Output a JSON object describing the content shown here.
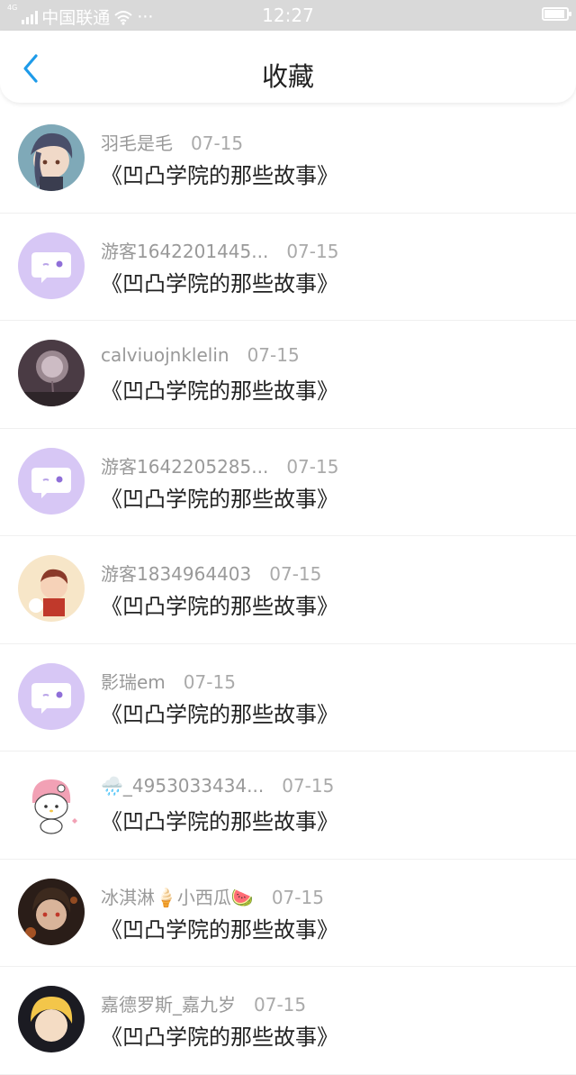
{
  "status_bar": {
    "signal_tag": "4G",
    "carrier": "中国联通",
    "more": "···",
    "time": "12:27"
  },
  "nav": {
    "title": "收藏"
  },
  "items": [
    {
      "username": "羽毛是毛",
      "date": "07-15",
      "title": "《凹凸学院的那些故事》"
    },
    {
      "username": "游客1642201445...",
      "date": "07-15",
      "title": "《凹凸学院的那些故事》"
    },
    {
      "username": "calviuojnklelin",
      "date": "07-15",
      "title": "《凹凸学院的那些故事》"
    },
    {
      "username": "游客1642205285...",
      "date": "07-15",
      "title": "《凹凸学院的那些故事》"
    },
    {
      "username": "游客1834964403",
      "date": "07-15",
      "title": "《凹凸学院的那些故事》"
    },
    {
      "username": "影瑞em",
      "date": "07-15",
      "title": "《凹凸学院的那些故事》"
    },
    {
      "username": "🌧️_4953033434...",
      "date": "07-15",
      "title": "《凹凸学院的那些故事》"
    },
    {
      "username": "冰淇淋🍦小西瓜🍉",
      "date": "07-15",
      "title": "《凹凸学院的那些故事》"
    },
    {
      "username": "嘉德罗斯_嘉九岁",
      "date": "07-15",
      "title": "《凹凸学院的那些故事》"
    }
  ],
  "colors": {
    "accent": "#1e9be9",
    "default_avatar": "#d7c7f5",
    "status_bar_bg": "#d9d9d9"
  },
  "icons": {
    "back": "chevron-left-icon",
    "wifi": "wifi-icon",
    "battery": "battery-icon",
    "signal": "signal-icon"
  }
}
